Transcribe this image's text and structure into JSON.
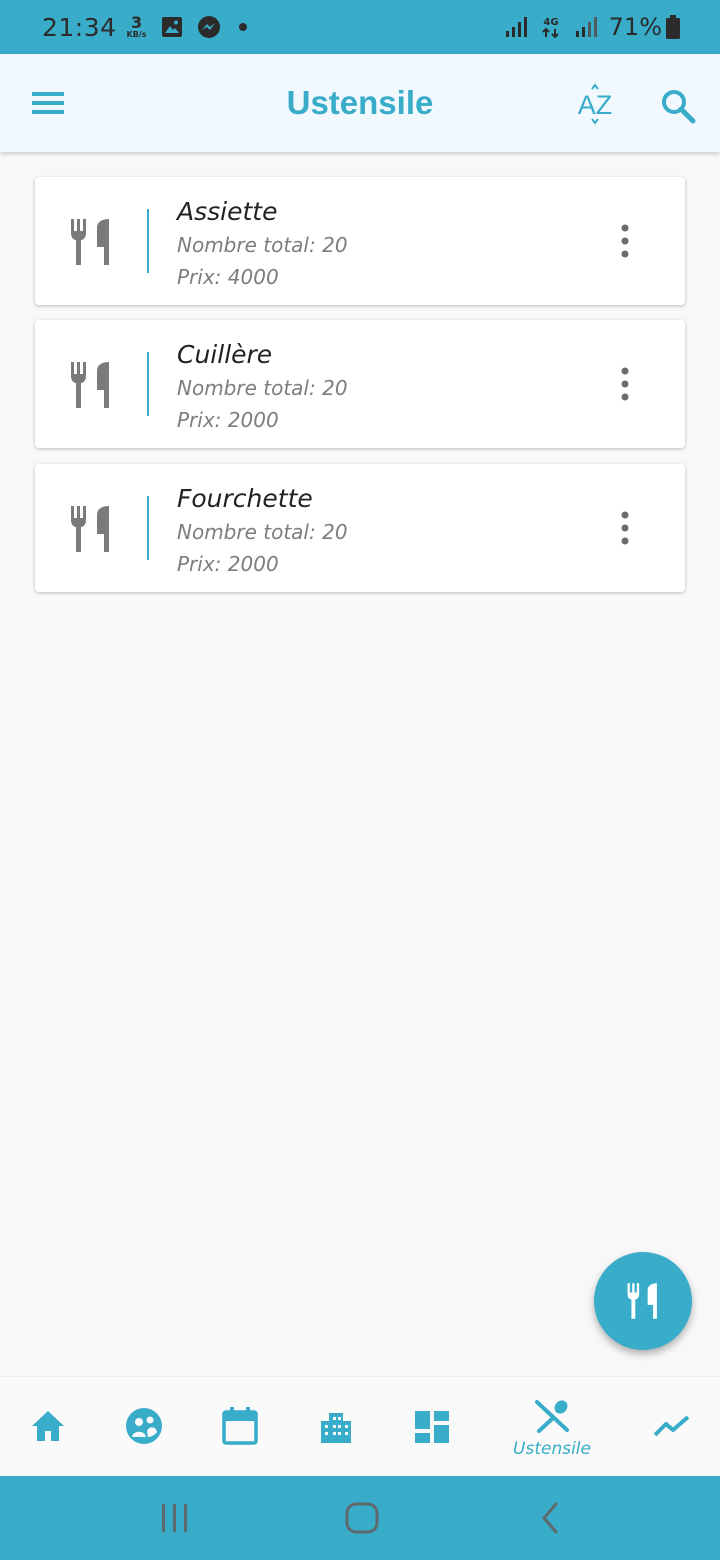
{
  "status_bar": {
    "time": "21:34",
    "net_speed_value": "3",
    "net_speed_unit": "KB/s",
    "network_type": "4G",
    "battery": "71%",
    "icons": [
      "gallery-icon",
      "messenger-icon",
      "notification-dot",
      "signal-icon",
      "signal-icon-2",
      "battery-icon"
    ]
  },
  "app_bar": {
    "title": "Ustensile",
    "sort_label": "AZ",
    "icons": [
      "menu-icon",
      "sort-az-icon",
      "search-icon"
    ]
  },
  "items": [
    {
      "name": "Assiette",
      "total": "Nombre total: 20",
      "price": "Prix: 4000"
    },
    {
      "name": "Cuillère",
      "total": "Nombre total: 20",
      "price": "Prix: 2000"
    },
    {
      "name": "Fourchette",
      "total": "Nombre total: 20",
      "price": "Prix: 2000"
    }
  ],
  "fab": {
    "icon": "utensils-icon"
  },
  "bottom_nav": {
    "active_label": "Ustensile",
    "items": [
      "home-icon",
      "people-icon",
      "calendar-icon",
      "building-icon",
      "dashboard-icon",
      "utensils-cross-icon",
      "trending-icon"
    ]
  },
  "colors": {
    "primary": "#38acc9",
    "app_bar_bg": "#f1f9fe",
    "page_bg": "#f8f8f8",
    "icon_gray": "#7a7a7a",
    "secondary_text": "#7d7d7d"
  }
}
